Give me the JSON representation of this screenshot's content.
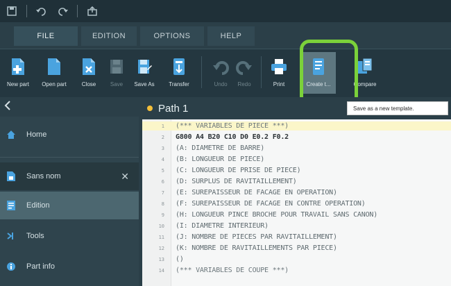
{
  "tabs": [
    "FILE",
    "EDITION",
    "OPTIONS",
    "HELP"
  ],
  "ribbon": {
    "buttons": [
      {
        "label": "New part",
        "icon": "new-part-icon"
      },
      {
        "label": "Open part",
        "icon": "open-part-icon"
      },
      {
        "label": "Close",
        "icon": "close-doc-icon"
      },
      {
        "label": "Save",
        "icon": "save-icon",
        "disabled": true
      },
      {
        "label": "Save As",
        "icon": "save-as-icon"
      },
      {
        "label": "Transfer",
        "icon": "transfer-icon"
      },
      {
        "label": "Undo",
        "icon": "undo-icon",
        "disabled": true
      },
      {
        "label": "Redo",
        "icon": "redo-icon",
        "disabled": true
      },
      {
        "label": "Print",
        "icon": "print-icon"
      },
      {
        "label": "Create t...",
        "icon": "create-template-icon"
      },
      {
        "label": "Compare",
        "icon": "compare-icon"
      }
    ]
  },
  "tooltip": "Save as a new template.",
  "sidebar": {
    "items": [
      {
        "label": "Home",
        "icon": "home-icon"
      },
      {
        "label": "Sans nom",
        "icon": "document-icon",
        "closable": true
      },
      {
        "label": "Edition",
        "icon": "edit-icon",
        "selected": true
      },
      {
        "label": "Tools",
        "icon": "tools-icon"
      },
      {
        "label": "Part info",
        "icon": "info-icon"
      }
    ]
  },
  "editor": {
    "title": "Path 1",
    "lines": [
      {
        "n": "1",
        "text": "(*** VARIABLES DE PIECE ***)"
      },
      {
        "n": "2",
        "text": "G800 A4 B20 C10 D0 E0.2 F0.2"
      },
      {
        "n": "3",
        "text": "(A: DIAMETRE DE BARRE)"
      },
      {
        "n": "4",
        "text": "(B: LONGUEUR DE PIECE)"
      },
      {
        "n": "5",
        "text": "(C: LONGUEUR DE PRISE DE PIECE)"
      },
      {
        "n": "6",
        "text": "(D: SURPLUS DE RAVITAILLEMENT)"
      },
      {
        "n": "7",
        "text": "(E: SUREPAISSEUR DE FACAGE EN OPERATION)"
      },
      {
        "n": "8",
        "text": "(F: SUREPAISSEUR DE FACAGE EN CONTRE OPERATION)"
      },
      {
        "n": "9",
        "text": "(H: LONGUEUR PINCE BROCHE POUR TRAVAIL SANS CANON)"
      },
      {
        "n": "10",
        "text": "(I: DIAMETRE INTERIEUR)"
      },
      {
        "n": "11",
        "text": "(J: NOMBRE DE PIECES PAR RAVITAILLEMENT)"
      },
      {
        "n": "12",
        "text": "(K: NOMBRE DE RAVITAILLEMENTS PAR PIECE)"
      },
      {
        "n": "13",
        "text": "()"
      },
      {
        "n": "14",
        "text": "(*** VARIABLES DE COUPE ***)"
      }
    ]
  },
  "colors": {
    "accent_highlight": "#7bd13a",
    "modified_dot": "#f4bf3a",
    "line_highlight": "#fbf6c9"
  }
}
